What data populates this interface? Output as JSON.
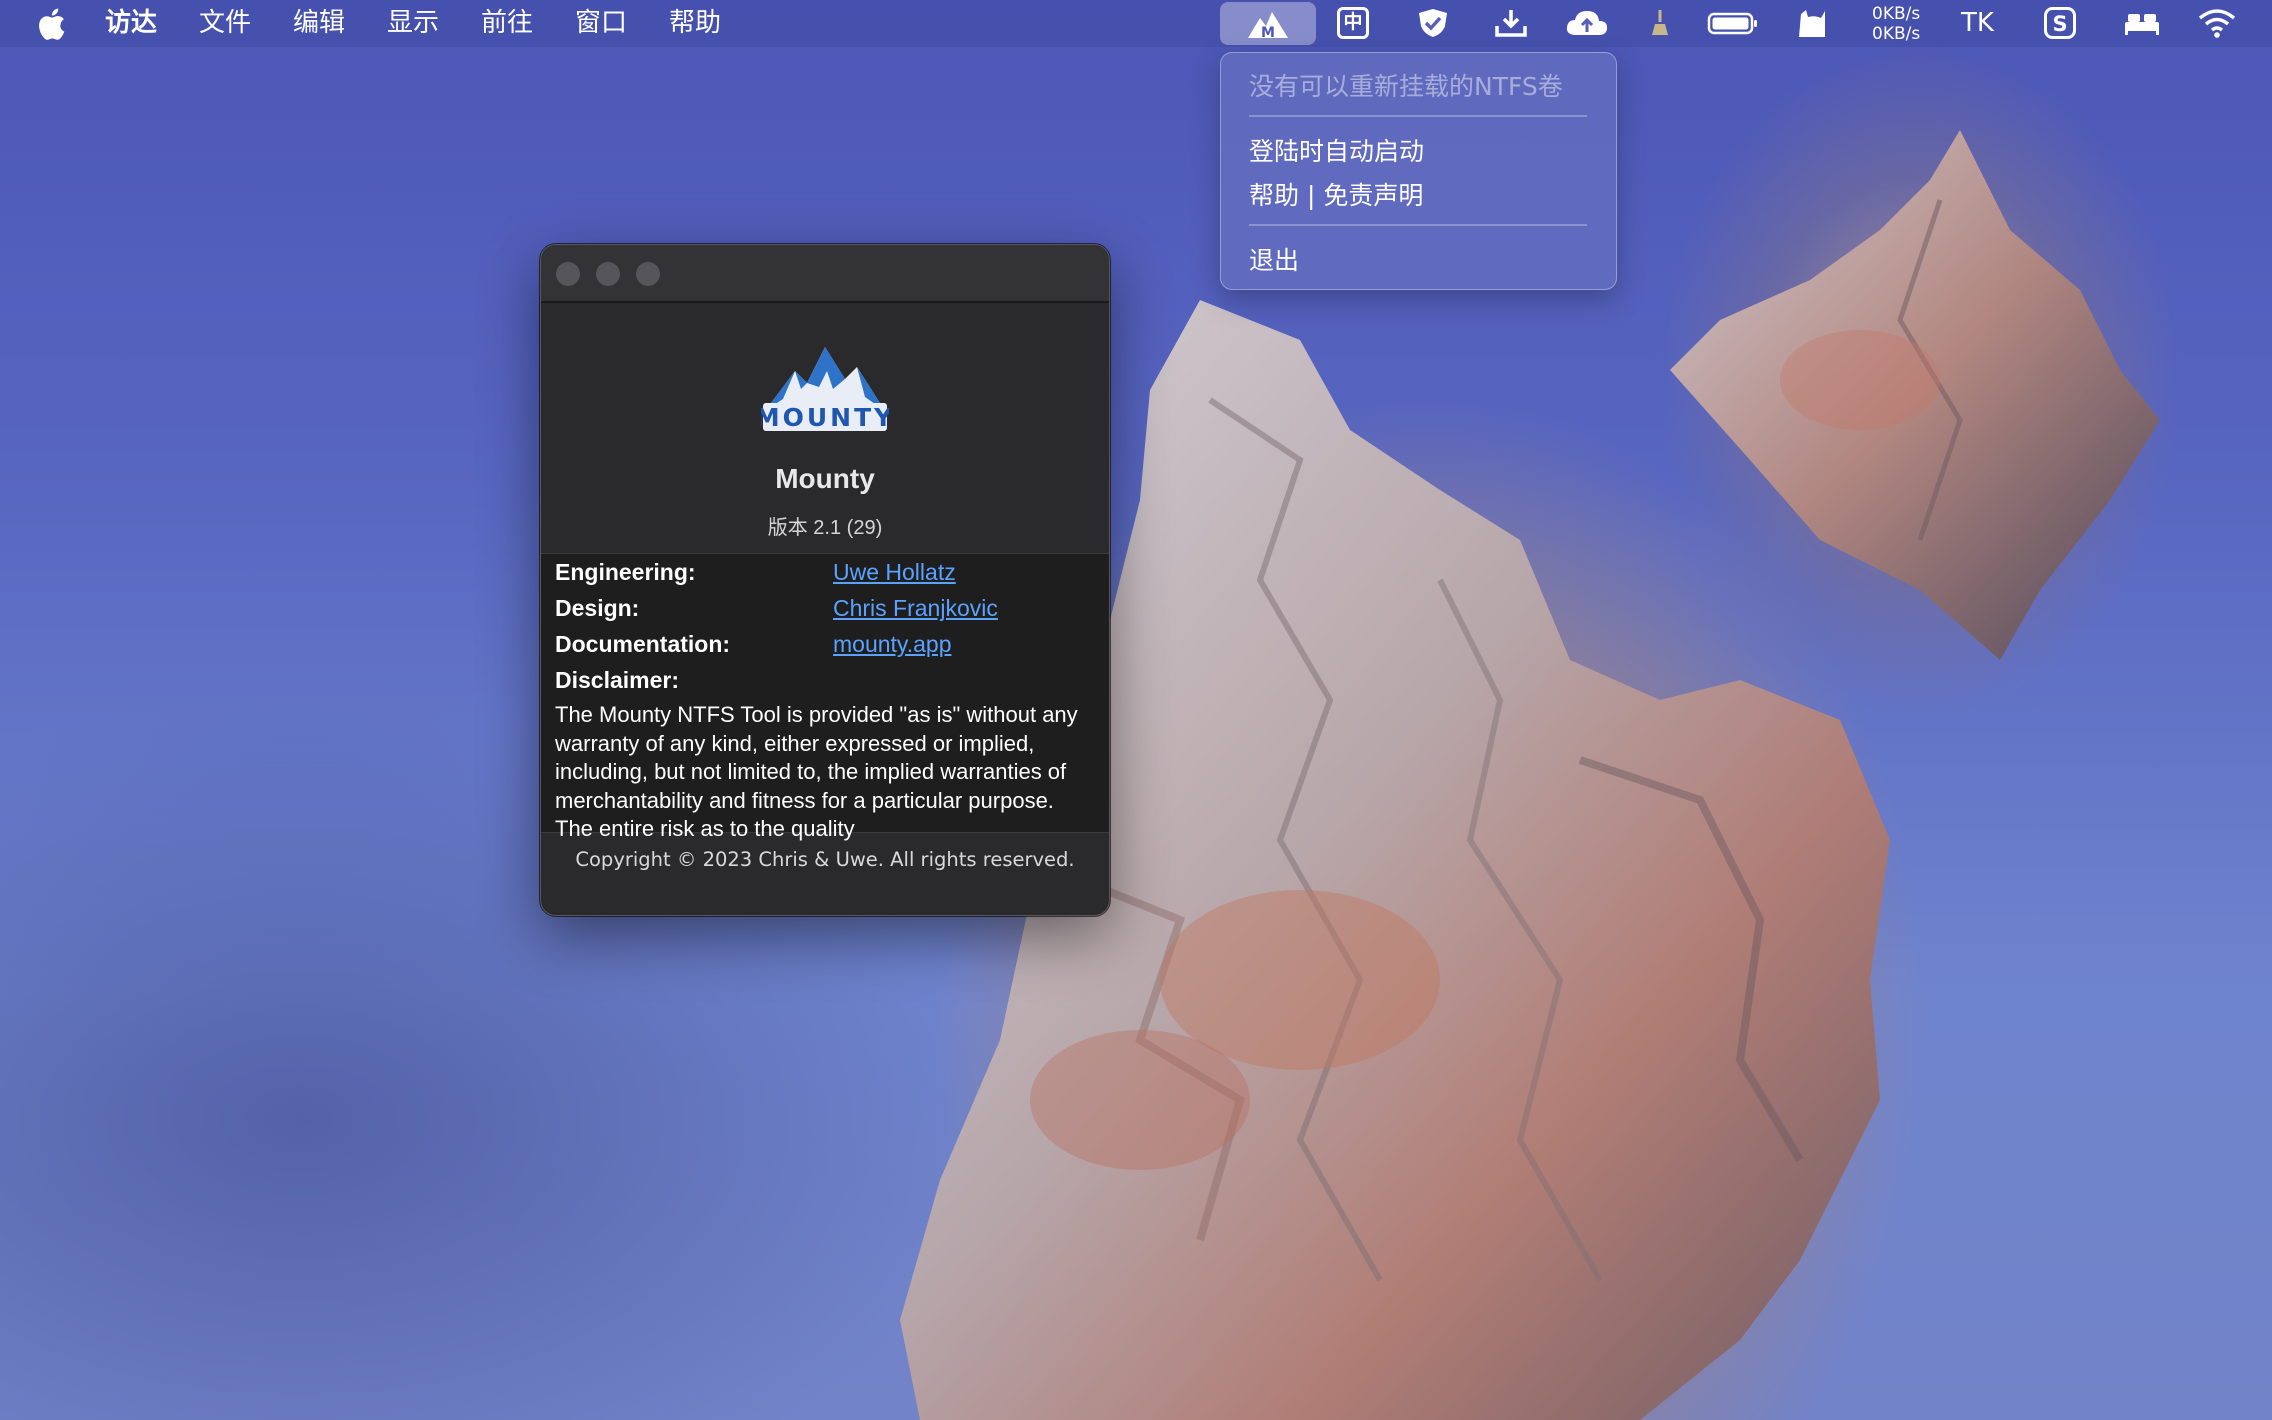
{
  "menubar": {
    "app_menu_items": [
      "访达",
      "文件",
      "编辑",
      "显示",
      "前往",
      "窗口",
      "帮助"
    ],
    "status_icons": [
      "mounty-icon",
      "input-method-icon",
      "shield-icon",
      "download-icon",
      "cloud-icon",
      "cleaner-icon",
      "battery-icon",
      "cat-icon",
      "network-speed",
      "tk-icon",
      "sogou-icon",
      "bed-icon",
      "wifi-icon"
    ],
    "input_method_label": "中",
    "network_speed": {
      "up": "0KB/s",
      "down": "0KB/s"
    },
    "tk_label": "TK"
  },
  "dropdown": {
    "disabled_item": "没有可以重新挂载的NTFS卷",
    "items": [
      "登陆时自动启动",
      "帮助 | 免责声明"
    ],
    "quit_label": "退出"
  },
  "about_window": {
    "app_name": "Mounty",
    "logo_text": "MOUNTY",
    "version": "版本 2.1 (29)",
    "credits": [
      {
        "label": "Engineering:",
        "value": "Uwe Hollatz"
      },
      {
        "label": "Design:",
        "value": "Chris Franjkovic"
      },
      {
        "label": "Documentation:",
        "value": "mounty.app"
      }
    ],
    "disclaimer_label": "Disclaimer:",
    "disclaimer_text": "The Mounty NTFS Tool is provided \"as is\" without any warranty of any kind, either expressed or implied, including, but not limited to, the implied warranties of merchantability and fitness for a particular purpose. The entire risk as to the quality",
    "copyright": "Copyright © 2023 Chris & Uwe. All rights reserved."
  },
  "colors": {
    "menubar": "#424ca8",
    "link": "#5ba2ff",
    "window_bg": "#2a2a2c"
  }
}
